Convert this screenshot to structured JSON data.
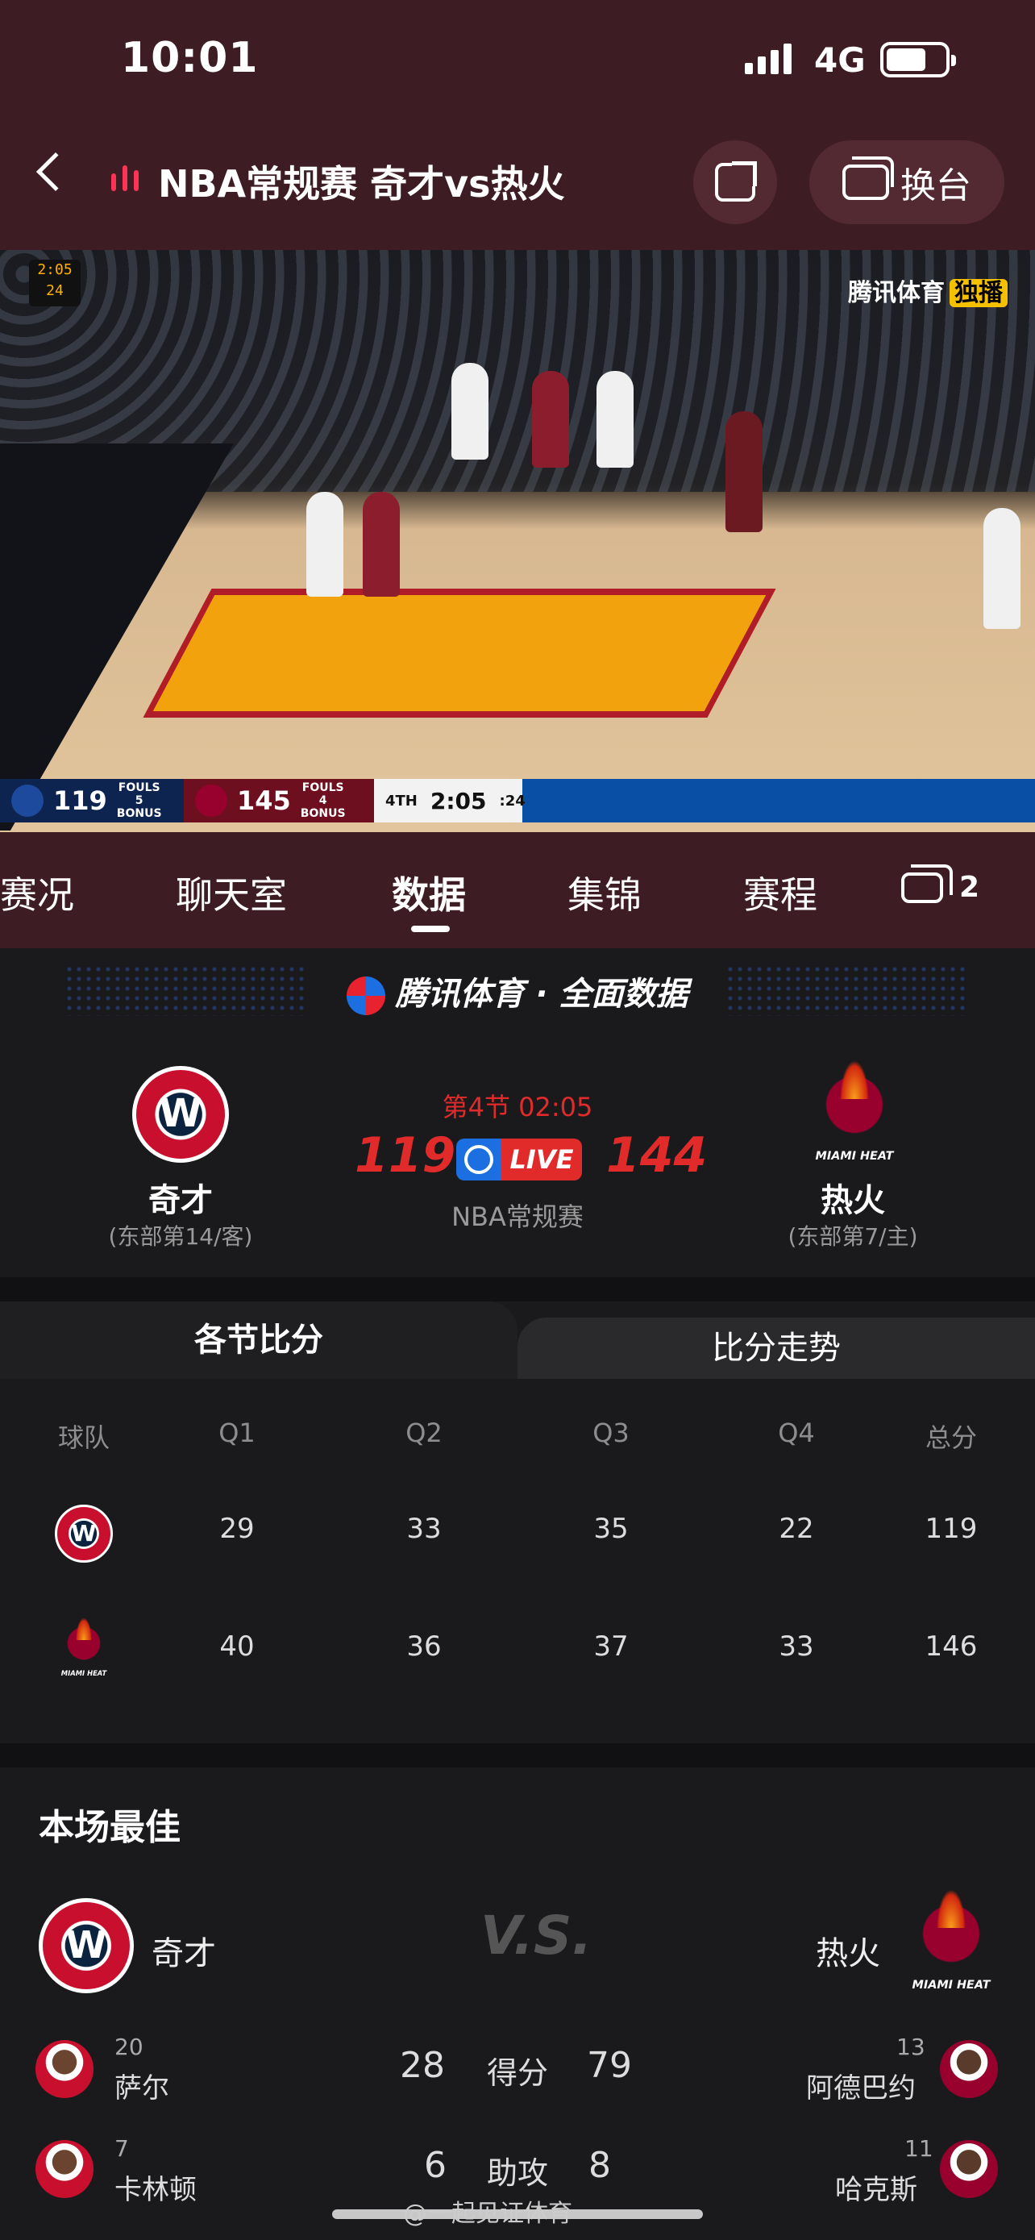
{
  "status": {
    "time": "10:01",
    "network": "4G"
  },
  "header": {
    "title": "NBA常规赛 奇才vs热火",
    "switch_label": "换台"
  },
  "video": {
    "watermark": "腾讯体育",
    "watermark_tag": "独播",
    "shot_clock_top": "2:05",
    "shot_clock_bottom": "24",
    "scorebug": {
      "away_score": "119",
      "away_fouls_label": "FOULS",
      "away_fouls": "5",
      "home_score": "145",
      "home_fouls_label": "FOULS",
      "home_fouls": "4",
      "bonus": "BONUS",
      "period": "4TH",
      "clock": "2:05",
      "shot": ":24"
    }
  },
  "tabs": [
    {
      "label": "赛况"
    },
    {
      "label": "聊天室"
    },
    {
      "label": "数据"
    },
    {
      "label": "集锦"
    },
    {
      "label": "赛程"
    }
  ],
  "tab_count": "2",
  "brand_banner": "腾讯体育 · 全面数据",
  "match": {
    "period_clock": "第4节 02:05",
    "away": {
      "name": "奇才",
      "sub": "(东部第14/客)",
      "score": "119"
    },
    "home": {
      "name": "热火",
      "sub": "(东部第7/主)",
      "score": "144"
    },
    "live_label": "LIVE",
    "league": "NBA常规赛"
  },
  "quarters": {
    "tab_left": "各节比分",
    "tab_right": "比分走势",
    "headers": [
      "球队",
      "Q1",
      "Q2",
      "Q3",
      "Q4",
      "总分"
    ],
    "rows": [
      {
        "team": "wizards",
        "values": [
          "29",
          "33",
          "35",
          "22",
          "119"
        ]
      },
      {
        "team": "heat",
        "values": [
          "40",
          "36",
          "37",
          "33",
          "146"
        ]
      }
    ]
  },
  "best": {
    "title": "本场最佳",
    "away_team": "奇才",
    "home_team": "热火",
    "vs": "V.S.",
    "stats": [
      {
        "label": "得分",
        "away": {
          "number": "20",
          "name": "萨尔",
          "value": "28"
        },
        "home": {
          "number": "13",
          "name": "阿德巴约",
          "value": "79"
        }
      },
      {
        "label": "助攻",
        "away": {
          "number": "7",
          "name": "卡林顿",
          "value": "6"
        },
        "home": {
          "number": "11",
          "name": "哈克斯",
          "value": "8"
        }
      }
    ]
  },
  "footer_watermark": "@一起见证体育"
}
